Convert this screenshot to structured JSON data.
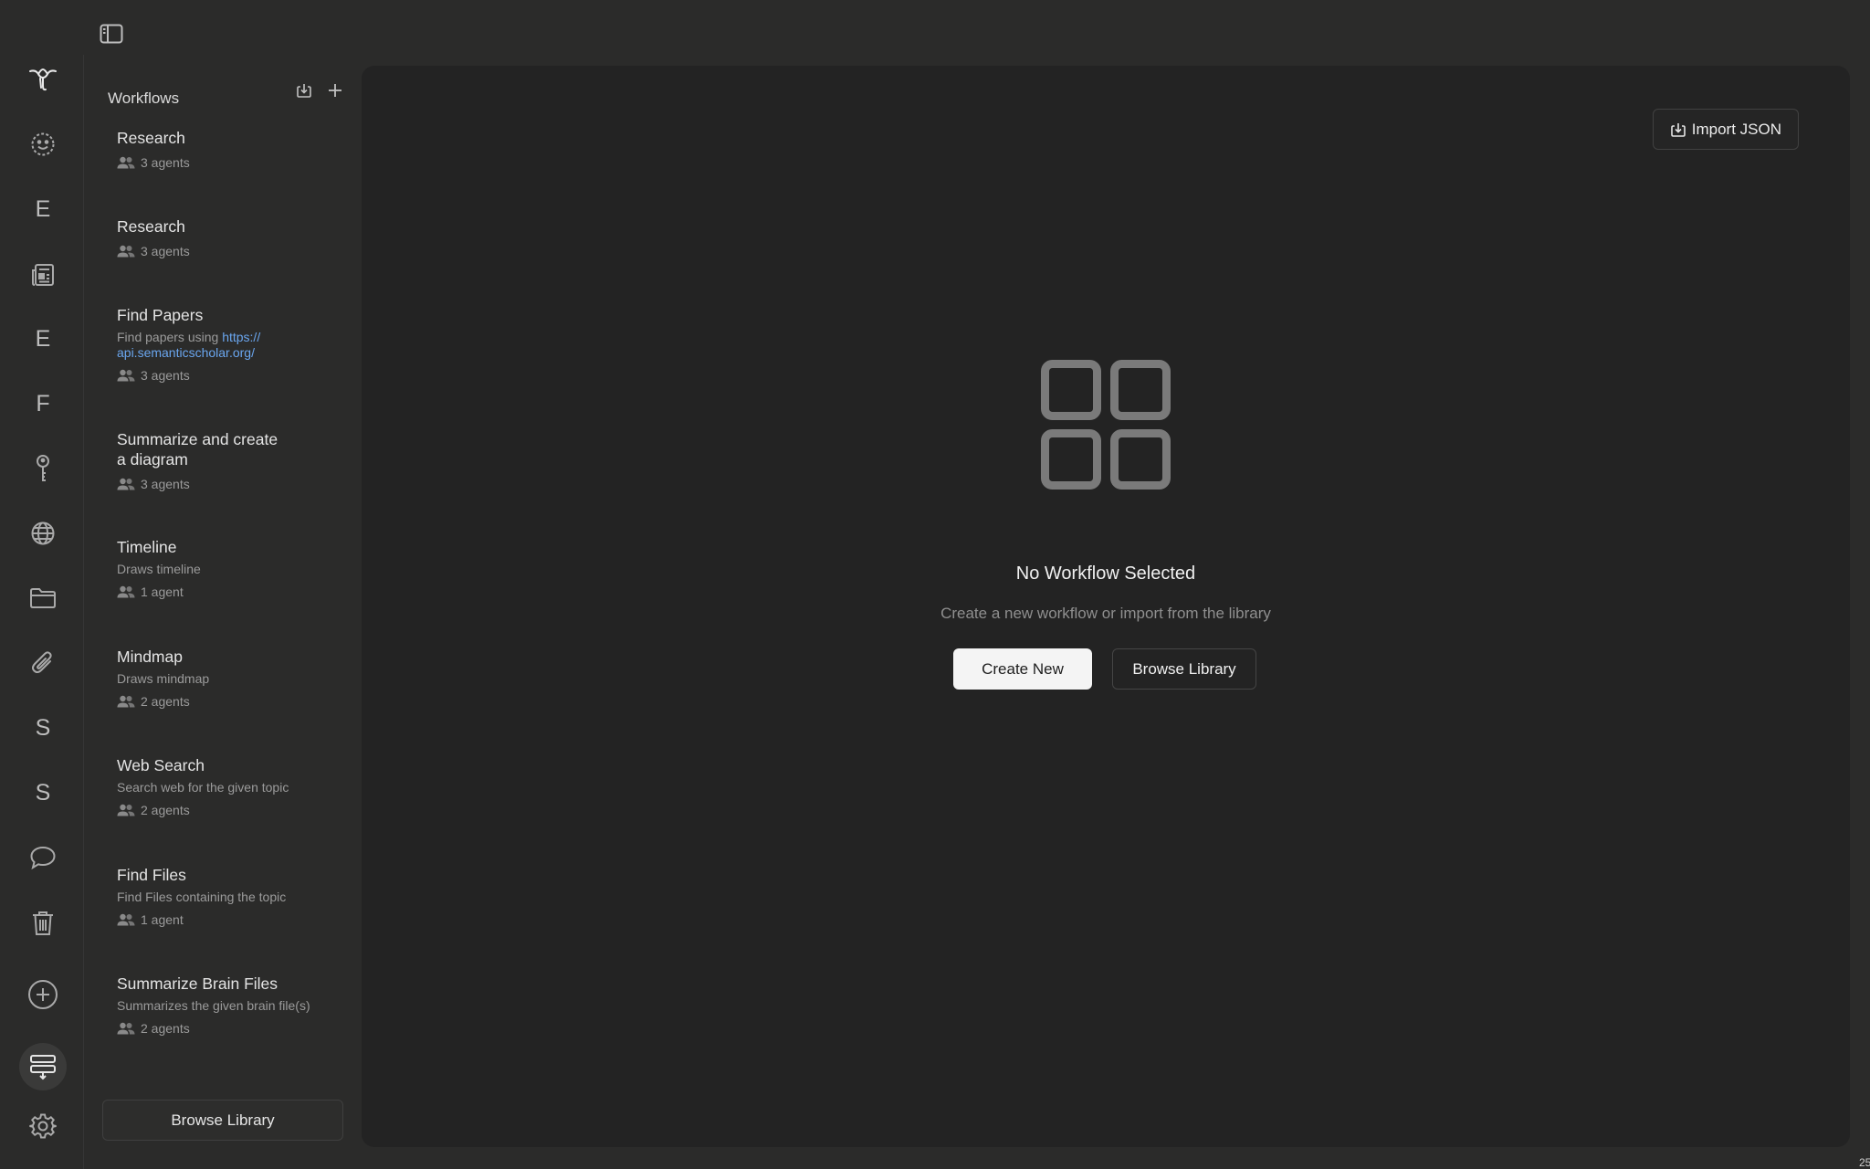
{
  "sidebar_rail": {
    "items": [
      {
        "icon": "elephant-logo-icon"
      },
      {
        "icon": "smiley-icon"
      },
      {
        "letter": "E"
      },
      {
        "icon": "newspaper-icon"
      },
      {
        "letter": "E"
      },
      {
        "letter": "F"
      },
      {
        "icon": "key-icon"
      },
      {
        "icon": "globe-icon"
      },
      {
        "icon": "folder-icon"
      },
      {
        "icon": "paperclip-icon"
      },
      {
        "letter": "S"
      },
      {
        "letter": "S"
      },
      {
        "icon": "chat-bubble-icon"
      },
      {
        "icon": "trash-icon"
      },
      {
        "icon": "plus-circle-icon"
      },
      {
        "icon": "workflow-icon"
      },
      {
        "icon": "gear-icon"
      }
    ]
  },
  "panel": {
    "title": "Workflows",
    "browse_label": "Browse Library",
    "workflows": [
      {
        "name": "Research",
        "desc": "",
        "agents": "3 agents"
      },
      {
        "name": "Research",
        "desc": "",
        "agents": "3 agents"
      },
      {
        "name": "Find Papers",
        "desc": "Find papers using ",
        "link": "https://\napi.semanticscholar.org/",
        "agents": "3 agents"
      },
      {
        "name": "Summarize and create\na diagram",
        "desc": "",
        "agents": "3 agents"
      },
      {
        "name": "Timeline",
        "desc": "Draws timeline",
        "agents": "1 agent"
      },
      {
        "name": "Mindmap",
        "desc": "Draws mindmap",
        "agents": "2 agents"
      },
      {
        "name": "Web Search",
        "desc": "Search web for the given topic",
        "agents": "2 agents"
      },
      {
        "name": "Find Files",
        "desc": "Find Files containing the topic",
        "agents": "1 agent"
      },
      {
        "name": "Summarize Brain Files",
        "desc": "Summarizes the given brain file(s)",
        "agents": "2 agents"
      }
    ]
  },
  "main": {
    "import_label": "Import JSON",
    "empty_title": "No Workflow Selected",
    "empty_subtitle": "Create a new workflow or import from the library",
    "create_label": "Create New",
    "browse_label": "Browse Library"
  },
  "corner_text": "25",
  "colors": {
    "background": "#2b2b2a",
    "main": "#232323",
    "link": "#6aa6ef"
  }
}
